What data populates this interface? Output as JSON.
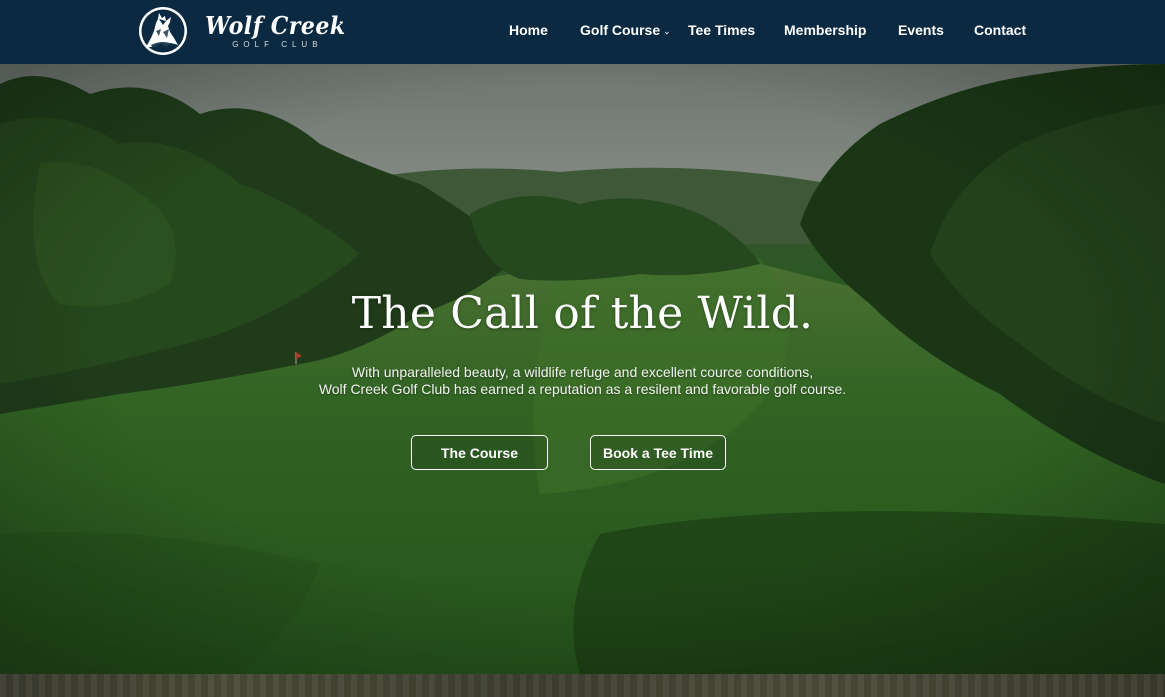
{
  "brand": {
    "name": "Wolf Creek",
    "tagline": "GOLF CLUB"
  },
  "nav": {
    "items": [
      {
        "label": "Home"
      },
      {
        "label": "Golf Course",
        "has_dropdown": true
      },
      {
        "label": "Tee Times"
      },
      {
        "label": "Membership"
      },
      {
        "label": "Events"
      },
      {
        "label": "Contact"
      }
    ]
  },
  "hero": {
    "title": "The Call of the Wild.",
    "subtitle_line1": "With unparalleled beauty, a wildlife refuge and excellent cource conditions,",
    "subtitle_line2": "Wolf Creek Golf Club has earned a reputation as a resilent and favorable golf course.",
    "primary_button": "The Course",
    "secondary_button": "Book a Tee Time"
  },
  "icons": {
    "logo": "wolf-howling-icon",
    "dropdown": "chevron-down-icon"
  },
  "colors": {
    "header_bg": "#0b2a41",
    "text": "#ffffff",
    "fairway": "#336b23"
  }
}
